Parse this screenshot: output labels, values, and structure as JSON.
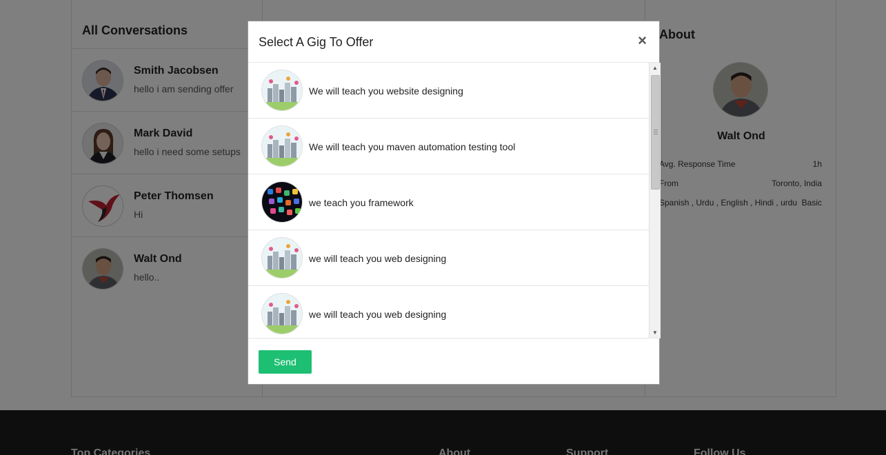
{
  "conversations": {
    "title": "All Conversations",
    "items": [
      {
        "name": "Smith Jacobsen",
        "message": "hello i am sending offer"
      },
      {
        "name": "Mark David",
        "message": "hello i need some setups"
      },
      {
        "name": "Peter Thomsen",
        "message": "Hi"
      },
      {
        "name": "Walt Ond",
        "message": "hello.."
      }
    ]
  },
  "about": {
    "title": "About",
    "name": "Walt Ond",
    "response_label": "Avg. Response Time",
    "response_value": "1h",
    "from_label": "From",
    "from_value": "Toronto, India",
    "languages": "Spanish , Urdu , English , Hindi , urdu",
    "level": "Basic"
  },
  "footer": {
    "headings": [
      "Top Categories",
      "About",
      "Support",
      "Follow Us"
    ]
  },
  "modal": {
    "title": "Select A Gig To Offer",
    "close": "×",
    "gigs": [
      {
        "title": "We will teach you website designing",
        "thumb": "city-icon"
      },
      {
        "title": "We will teach you maven automation testing tool",
        "thumb": "city-icon"
      },
      {
        "title": "we teach you framework",
        "thumb": "phone-apps-icon"
      },
      {
        "title": "we will teach you web designing",
        "thumb": "city-icon"
      },
      {
        "title": "we will teach you web designing",
        "thumb": "city-icon"
      }
    ],
    "send_label": "Send"
  },
  "colors": {
    "accent": "#1dbf73",
    "overlay": "rgba(0,0,0,0.5)",
    "footer": "#1d1d1d"
  }
}
